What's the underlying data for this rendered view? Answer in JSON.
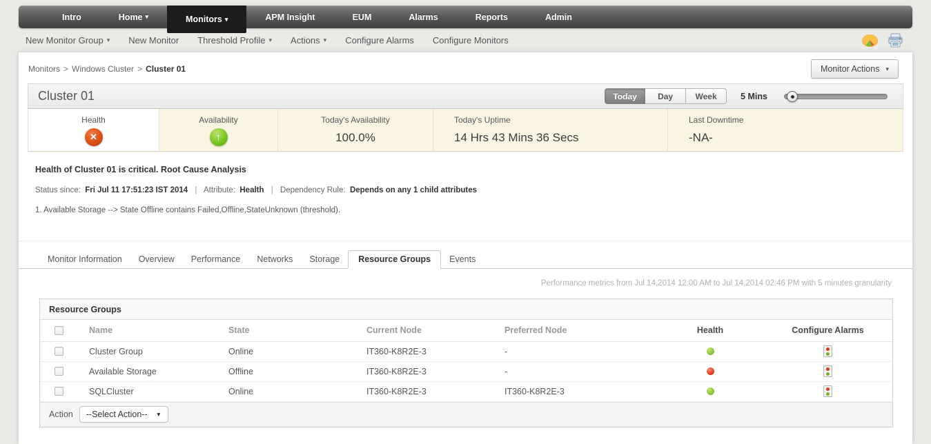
{
  "icons": {
    "chevron_down": "▾",
    "caret_down": "▼"
  },
  "nav": {
    "items": [
      {
        "label": "Intro"
      },
      {
        "label": "Home"
      },
      {
        "label": "Monitors"
      },
      {
        "label": "APM Insight"
      },
      {
        "label": "EUM"
      },
      {
        "label": "Alarms"
      },
      {
        "label": "Reports"
      },
      {
        "label": "Admin"
      }
    ],
    "active": "Monitors"
  },
  "toolbar": {
    "items": [
      {
        "label": "New Monitor Group"
      },
      {
        "label": "New Monitor"
      },
      {
        "label": "Threshold Profile"
      },
      {
        "label": "Actions"
      },
      {
        "label": "Configure Alarms"
      },
      {
        "label": "Configure Monitors"
      }
    ]
  },
  "breadcrumb": {
    "separator": ">",
    "parts": [
      "Monitors",
      "Windows Cluster",
      "Cluster 01"
    ]
  },
  "monitor_actions": {
    "label": "Monitor Actions"
  },
  "header": {
    "title": "Cluster 01",
    "period_buttons": [
      "Today",
      "Day",
      "Week"
    ],
    "active_period": "Today",
    "granularity_label": "5 Mins"
  },
  "stats": {
    "cells": [
      {
        "label": "Health",
        "icon": "critical-red-x"
      },
      {
        "label": "Availability",
        "icon": "up-green-arrow"
      },
      {
        "label": "Today's Availability",
        "value": "100.0%"
      },
      {
        "label": "Today's Uptime",
        "value": "14 Hrs 43 Mins 36 Secs"
      },
      {
        "label": "Last Downtime",
        "value": "-NA-"
      }
    ]
  },
  "rca": {
    "heading": "Health of Cluster 01 is critical. Root Cause Analysis",
    "separator": "|",
    "status_since_label": "Status since:",
    "status_since_value": "Fri Jul 11 17:51:23 IST 2014",
    "attribute_label": "Attribute:",
    "attribute_value": "Health",
    "dependency_label": "Dependency Rule:",
    "dependency_value": "Depends on any 1 child attributes",
    "detail": "1. Available Storage --> State Offline contains Failed,Offline,StateUnknown (threshold)."
  },
  "tabs": {
    "items": [
      "Monitor Information",
      "Overview",
      "Performance",
      "Networks",
      "Storage",
      "Resource Groups",
      "Events"
    ],
    "active": "Resource Groups"
  },
  "perf_note": "Performance metrics from Jul 14,2014 12:00 AM to Jul 14,2014 02:46 PM with 5 minutes granularity",
  "table": {
    "title": "Resource Groups",
    "columns": [
      "Name",
      "State",
      "Current Node",
      "Preferred Node",
      "Health",
      "Configure Alarms"
    ],
    "rows": [
      {
        "name": "Cluster Group",
        "state": "Online",
        "current_node": "IT360-K8R2E-3",
        "preferred_node": "-",
        "health": "green"
      },
      {
        "name": "Available Storage",
        "state": "Offline",
        "current_node": "IT360-K8R2E-3",
        "preferred_node": "-",
        "health": "red"
      },
      {
        "name": "SQLCluster",
        "state": "Online",
        "current_node": "IT360-K8R2E-3",
        "preferred_node": "IT360-K8R2E-3",
        "health": "green"
      }
    ],
    "action_label": "Action",
    "action_select_value": "--Select Action--"
  },
  "colors": {
    "critical_red": "#d94f16",
    "ok_green": "#79c622",
    "health_dot_green": "#8dc63f",
    "health_dot_red": "#e6452a",
    "stats_panel_bg": "#faf4e2",
    "nav_active_bg": "#1c1c1c"
  }
}
